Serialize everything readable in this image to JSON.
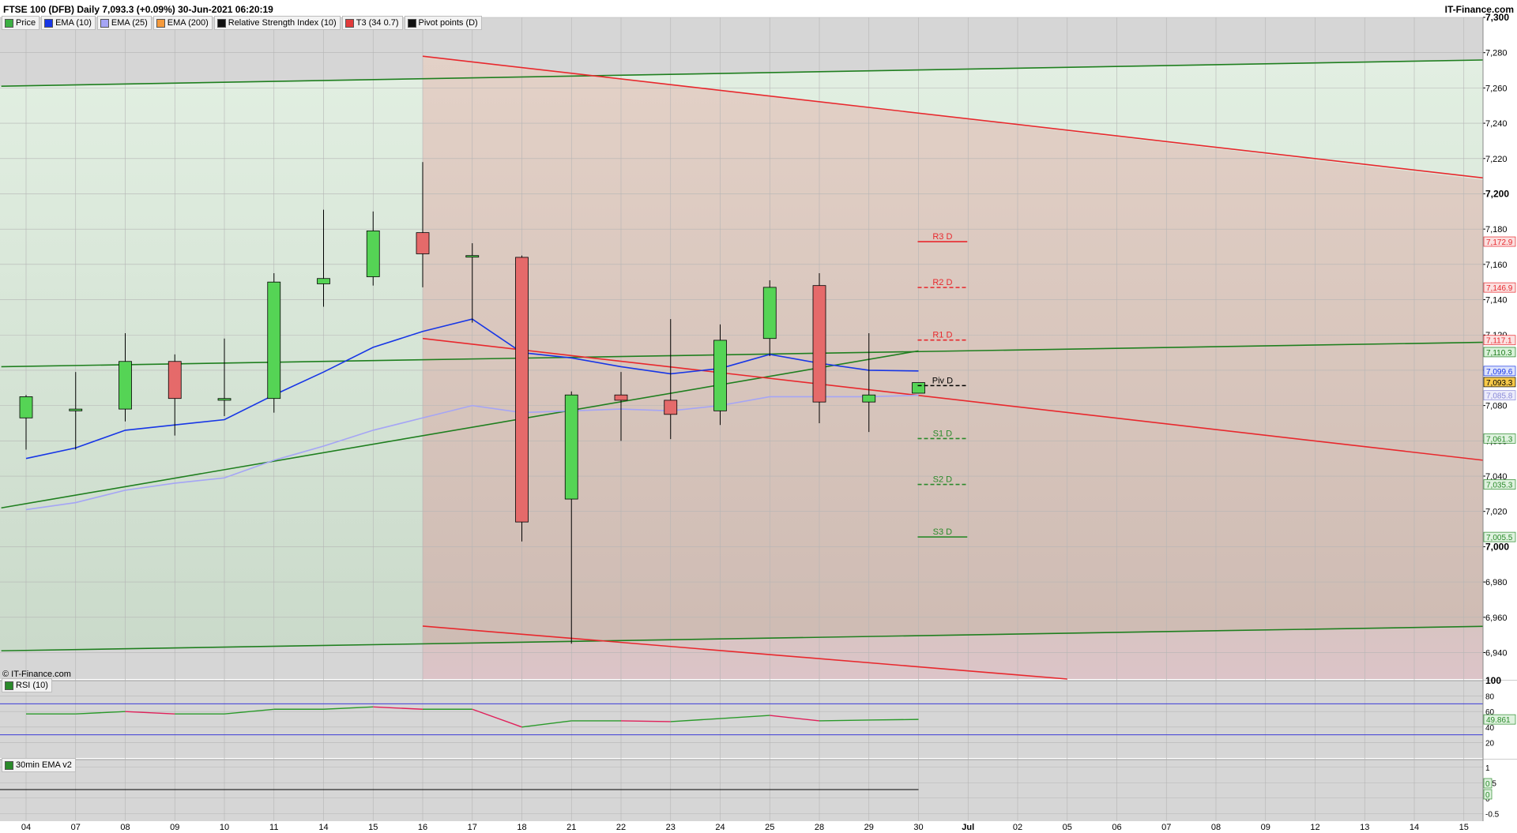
{
  "header": {
    "title": "FTSE 100 (DFB) Daily 7,093.3 (+0.09%) 30-Jun-2021 06:20:19",
    "brand": "IT-Finance.com"
  },
  "legend": [
    {
      "label": "Price",
      "color": "#3cb043"
    },
    {
      "label": "EMA (10)",
      "color": "#1736e6"
    },
    {
      "label": "EMA (25)",
      "color": "#a5a5f5"
    },
    {
      "label": "EMA (200)",
      "color": "#f59a3c"
    },
    {
      "label": "Relative Strength Index (10)",
      "color": "#111111"
    },
    {
      "label": "T3 (34 0.7)",
      "color": "#e23b3b"
    },
    {
      "label": "Pivot points (D)",
      "color": "#111111"
    }
  ],
  "copyright": "© IT-Finance.com",
  "rsi_panel": {
    "label": "RSI (10)",
    "value_tag": "49.861",
    "ticks": [
      "100",
      "80",
      "60",
      "40",
      "20"
    ]
  },
  "ema_panel": {
    "label": "30min EMA v2",
    "ticks": [
      "1",
      "0.5",
      "0",
      "-0.5"
    ],
    "tags": [
      "0",
      "0"
    ]
  },
  "chart_data": {
    "type": "candlestick",
    "x_labels": [
      "04",
      "07",
      "08",
      "09",
      "10",
      "11",
      "14",
      "15",
      "16",
      "17",
      "18",
      "21",
      "22",
      "23",
      "24",
      "25",
      "28",
      "29",
      "30",
      "Jul",
      "02",
      "05",
      "06",
      "07",
      "08",
      "09",
      "12",
      "13",
      "14",
      "15"
    ],
    "ylim": [
      6925,
      7300
    ],
    "y_ticks": [
      6940,
      6960,
      6980,
      7000,
      7020,
      7040,
      7060,
      7080,
      7100,
      7120,
      7140,
      7160,
      7180,
      7200,
      7220,
      7240,
      7260,
      7280,
      7300
    ],
    "y_tick_labels": [
      "6,940",
      "6,960",
      "6,980",
      "7,000",
      "7,020",
      "7,040",
      "7,060",
      "7,080",
      "7,100",
      "7,120",
      "7,140",
      "7,160",
      "7,180",
      "7,200",
      "7,220",
      "7,240",
      "7,260",
      "7,280",
      "7,300"
    ],
    "candles": [
      {
        "x": "04",
        "o": 7073,
        "h": 7086,
        "l": 7055,
        "c": 7085
      },
      {
        "x": "07",
        "o": 7077,
        "h": 7099,
        "l": 7055,
        "c": 7078
      },
      {
        "x": "08",
        "o": 7078,
        "h": 7121,
        "l": 7071,
        "c": 7105
      },
      {
        "x": "09",
        "o": 7105,
        "h": 7109,
        "l": 7063,
        "c": 7084
      },
      {
        "x": "10",
        "o": 7083,
        "h": 7118,
        "l": 7074,
        "c": 7084
      },
      {
        "x": "11",
        "o": 7084,
        "h": 7155,
        "l": 7076,
        "c": 7150
      },
      {
        "x": "14",
        "o": 7149,
        "h": 7191,
        "l": 7136,
        "c": 7152
      },
      {
        "x": "15",
        "o": 7153,
        "h": 7190,
        "l": 7148,
        "c": 7179
      },
      {
        "x": "16",
        "o": 7178,
        "h": 7218,
        "l": 7147,
        "c": 7166
      },
      {
        "x": "17",
        "o": 7165,
        "h": 7172,
        "l": 7127,
        "c": 7165
      },
      {
        "x": "18",
        "o": 7164,
        "h": 7165,
        "l": 7003,
        "c": 7014
      },
      {
        "x": "21",
        "o": 7027,
        "h": 7088,
        "l": 6945,
        "c": 7086
      },
      {
        "x": "22",
        "o": 7086,
        "h": 7099,
        "l": 7060,
        "c": 7083
      },
      {
        "x": "23",
        "o": 7083,
        "h": 7129,
        "l": 7061,
        "c": 7075
      },
      {
        "x": "24",
        "o": 7077,
        "h": 7126,
        "l": 7069,
        "c": 7117
      },
      {
        "x": "25",
        "o": 7118,
        "h": 7151,
        "l": 7108,
        "c": 7147
      },
      {
        "x": "28",
        "o": 7148,
        "h": 7155,
        "l": 7070,
        "c": 7082
      },
      {
        "x": "29",
        "o": 7082,
        "h": 7121,
        "l": 7065,
        "c": 7086
      },
      {
        "x": "30",
        "o": 7087,
        "h": 7093,
        "l": 7087,
        "c": 7093
      }
    ],
    "ema10": [
      [
        0,
        7050
      ],
      [
        1,
        7056
      ],
      [
        2,
        7066
      ],
      [
        3,
        7069
      ],
      [
        4,
        7072
      ],
      [
        5,
        7086
      ],
      [
        6,
        7099
      ],
      [
        7,
        7113
      ],
      [
        8,
        7122
      ],
      [
        9,
        7129
      ],
      [
        10,
        7110
      ],
      [
        11,
        7107
      ],
      [
        12,
        7102
      ],
      [
        13,
        7098
      ],
      [
        14,
        7101
      ],
      [
        15,
        7109
      ],
      [
        16,
        7104
      ],
      [
        17,
        7100
      ],
      [
        18,
        7099.6
      ]
    ],
    "ema25": [
      [
        0,
        7021
      ],
      [
        1,
        7025
      ],
      [
        2,
        7032
      ],
      [
        3,
        7036
      ],
      [
        4,
        7039
      ],
      [
        5,
        7049
      ],
      [
        6,
        7057
      ],
      [
        7,
        7066
      ],
      [
        8,
        7073
      ],
      [
        9,
        7080
      ],
      [
        10,
        7076
      ],
      [
        11,
        7077
      ],
      [
        12,
        7078
      ],
      [
        13,
        7077
      ],
      [
        14,
        7080
      ],
      [
        15,
        7085
      ],
      [
        16,
        7085
      ],
      [
        17,
        7085
      ],
      [
        18,
        7085.8
      ]
    ],
    "pivots": [
      {
        "name": "R3 D",
        "value": 7172.9,
        "color": "#e8282d",
        "dash": false,
        "tag": "7,172.9"
      },
      {
        "name": "R2 D",
        "value": 7146.9,
        "color": "#e8282d",
        "dash": true,
        "tag": "7,146.9"
      },
      {
        "name": "R1 D",
        "value": 7117.1,
        "color": "#e8282d",
        "dash": true,
        "tag": "7,117.1"
      },
      {
        "name": "Piv D",
        "value": 7091.3,
        "color": "#000000",
        "dash": true,
        "tag": ""
      },
      {
        "name": "S1 D",
        "value": 7061.3,
        "color": "#2a8a2a",
        "dash": true,
        "tag": "7,061.3"
      },
      {
        "name": "S2 D",
        "value": 7035.3,
        "color": "#2a8a2a",
        "dash": true,
        "tag": "7,035.3"
      },
      {
        "name": "S3 D",
        "value": 7005.5,
        "color": "#2a8a2a",
        "dash": false,
        "tag": "7,005.5"
      }
    ],
    "price_tags": [
      {
        "value": 7110.3,
        "label": "7,110.3",
        "bg": "#d9f2d9",
        "fg": "#1a7a1a"
      },
      {
        "value": 7099.6,
        "label": "7,099.6",
        "bg": "#dde3fb",
        "fg": "#1736e6"
      },
      {
        "value": 7093.3,
        "label": "7,093.3",
        "bg": "#f7c948",
        "fg": "#000000"
      },
      {
        "value": 7085.8,
        "label": "7,085.8",
        "bg": "#ececfb",
        "fg": "#8a8ad8"
      }
    ],
    "trend_lines": [
      {
        "color": "#1f7f1f",
        "x1": -0.5,
        "y1": 7261,
        "x2": 29.7,
        "y2": 7276
      },
      {
        "color": "#1f7f1f",
        "x1": -0.5,
        "y1": 7102,
        "x2": 29.7,
        "y2": 7116
      },
      {
        "color": "#1f7f1f",
        "x1": -0.5,
        "y1": 6941,
        "x2": 29.7,
        "y2": 6955
      },
      {
        "color": "#1f7f1f",
        "x1": -0.5,
        "y1": 7022,
        "x2": 18,
        "y2": 7111
      },
      {
        "color": "#e8282d",
        "x1": 8,
        "y1": 7278,
        "x2": 29.7,
        "y2": 7208
      },
      {
        "color": "#e8282d",
        "x1": 8,
        "y1": 7118,
        "x2": 29.7,
        "y2": 7048
      },
      {
        "color": "#e8282d",
        "x1": 8,
        "y1": 6955,
        "x2": 21,
        "y2": 6925
      }
    ],
    "rsi": [
      [
        0,
        57
      ],
      [
        1,
        57
      ],
      [
        2,
        60
      ],
      [
        3,
        57
      ],
      [
        4,
        57
      ],
      [
        5,
        63
      ],
      [
        6,
        63
      ],
      [
        7,
        66
      ],
      [
        8,
        63
      ],
      [
        9,
        63
      ],
      [
        10,
        40
      ],
      [
        11,
        48
      ],
      [
        12,
        48
      ],
      [
        13,
        47
      ],
      [
        14,
        51
      ],
      [
        15,
        55
      ],
      [
        16,
        48
      ],
      [
        17,
        49
      ],
      [
        18,
        49.861
      ]
    ],
    "rsi_levels": [
      70,
      30
    ]
  }
}
